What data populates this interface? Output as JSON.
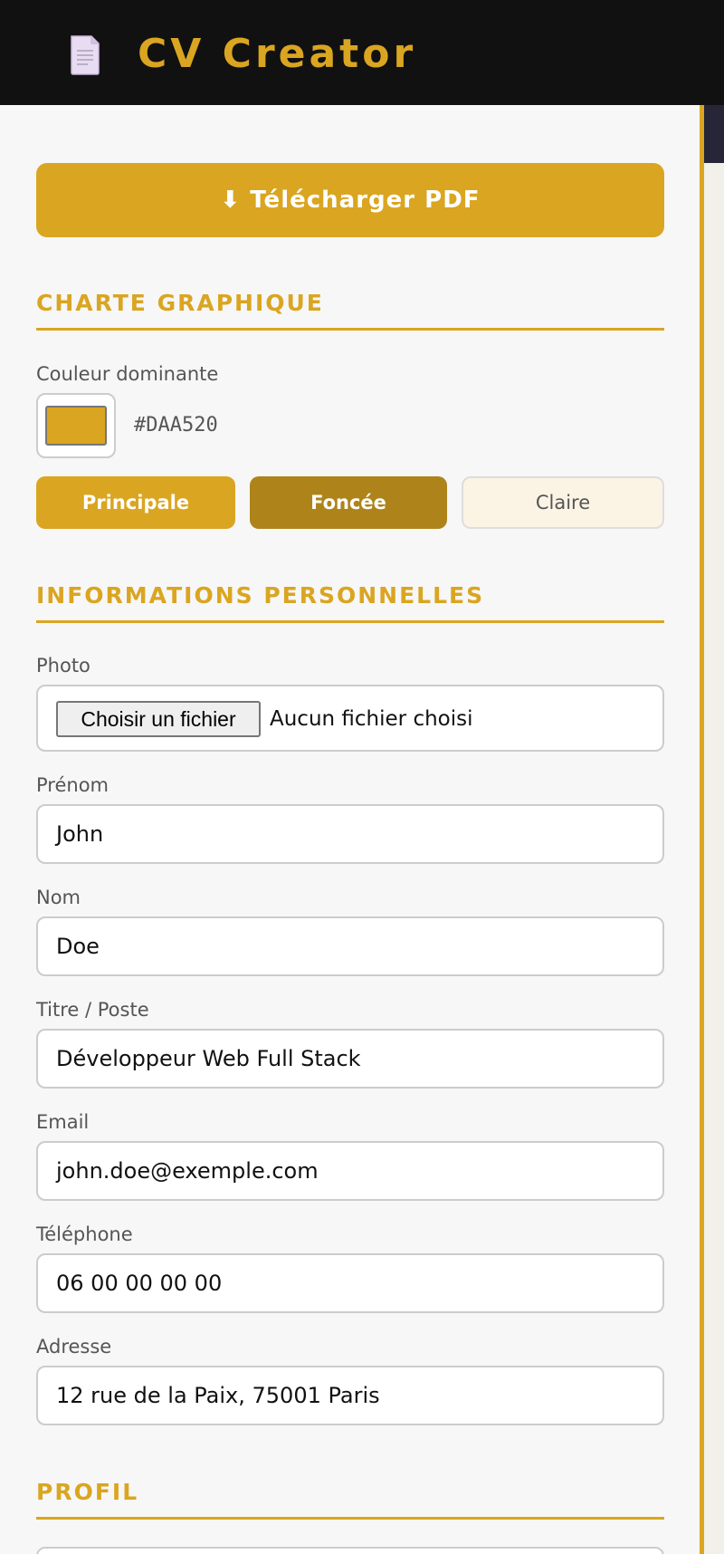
{
  "header": {
    "title": "CV Creator",
    "icon": "document-icon"
  },
  "actions": {
    "download_label": "⬇ Télécharger PDF"
  },
  "charte": {
    "title": "CHARTE GRAPHIQUE",
    "color_label": "Couleur dominante",
    "color_value": "#DAA520",
    "shades": {
      "main": "Principale",
      "dark": "Foncée",
      "light": "Claire"
    },
    "colors": {
      "main": "#DAA520",
      "dark": "#AE841A",
      "light": "#FBF4E4"
    }
  },
  "personal": {
    "title": "INFORMATIONS PERSONNELLES",
    "photo": {
      "label": "Photo",
      "button": "Choisir un fichier",
      "status": "Aucun fichier choisi"
    },
    "fields": [
      {
        "label": "Prénom",
        "value": "John"
      },
      {
        "label": "Nom",
        "value": "Doe"
      },
      {
        "label": "Titre / Poste",
        "value": "Développeur Web Full Stack"
      },
      {
        "label": "Email",
        "value": "john.doe@exemple.com"
      },
      {
        "label": "Téléphone",
        "value": "06 00 00 00 00"
      },
      {
        "label": "Adresse",
        "value": "12 rue de la Paix, 75001 Paris"
      }
    ]
  },
  "profil": {
    "title": "PROFIL"
  }
}
